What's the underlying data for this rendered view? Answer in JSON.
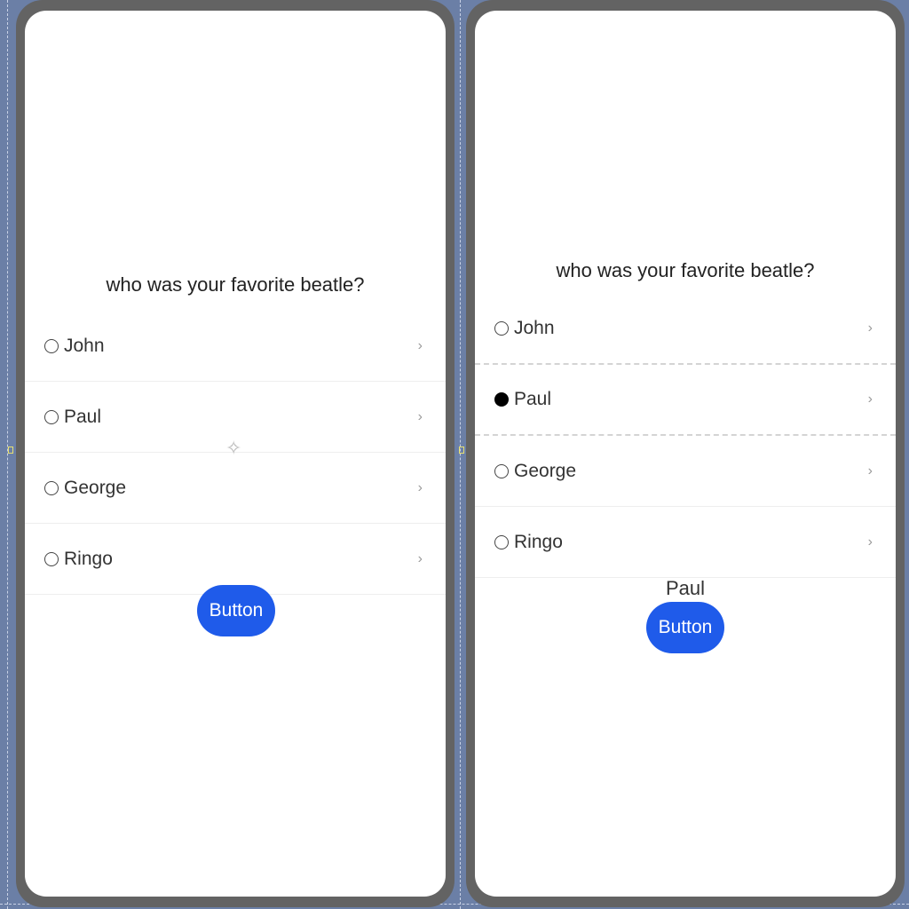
{
  "left_panel": {
    "question": "who was your favorite beatle?",
    "options": [
      {
        "label": "John",
        "selected": false
      },
      {
        "label": "Paul",
        "selected": false
      },
      {
        "label": "George",
        "selected": false
      },
      {
        "label": "Ringo",
        "selected": false
      }
    ],
    "button_label": "Button",
    "cursor_icon": "four-point-sparkle"
  },
  "right_panel": {
    "question": "who was your favorite beatle?",
    "options": [
      {
        "label": "John",
        "selected": false
      },
      {
        "label": "Paul",
        "selected": true
      },
      {
        "label": "George",
        "selected": false
      },
      {
        "label": "Ringo",
        "selected": false
      }
    ],
    "result_text": "Paul",
    "button_label": "Button"
  },
  "colors": {
    "button": "#1f5bea",
    "frame": "#636363",
    "backdrop": "#6b7fa6"
  }
}
